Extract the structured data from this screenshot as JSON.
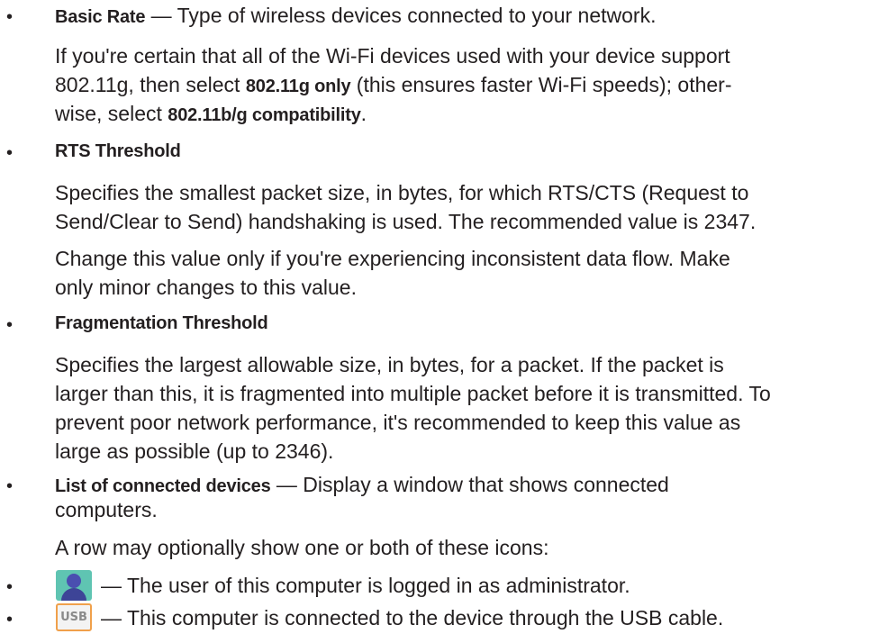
{
  "bullet_char": "•",
  "basic_rate": {
    "term": "Basic Rate",
    "desc": " — Type of wireless devices connected to your network.",
    "p1_l1": "If you're certain that all of the Wi-Fi devices used with your device support",
    "p1_l2a": "802.11g, then select ",
    "p1_l2_opt": "802.11g only",
    "p1_l2b": " (this ensures faster Wi-Fi speeds); other-",
    "p1_l3a": "wise, select ",
    "p1_l3_opt": "802.11b/g compatibility",
    "p1_l3b": "."
  },
  "rts": {
    "heading": "RTS Threshold",
    "p1_l1": "Specifies the smallest packet size, in bytes, for which RTS/CTS (Request to",
    "p1_l2": "Send/Clear to Send) handshaking is used. The recommended value is 2347.",
    "p2_l1": "Change this value only if you're experiencing inconsistent data flow. Make",
    "p2_l2": "only minor changes to this value."
  },
  "fragmentation": {
    "heading": "Fragmentation Threshold",
    "p1_l1": "Specifies the largest allowable size, in bytes, for a packet. If the packet is",
    "p1_l2": "larger than this, it is fragmented into multiple packet before it is transmitted. To",
    "p1_l3": "prevent poor network performance, it's recommended to keep this value as",
    "p1_l4": "large as possible (up to 2346)."
  },
  "connected_devices": {
    "term": "List of connected devices",
    "desc_l1": " — Display a window that shows connected",
    "desc_l2": "computers.",
    "icons_intro": "A row may optionally show one or both of these icons:"
  },
  "icons": {
    "admin_icon": "admin-user-icon",
    "admin_desc": "— The user of this computer is logged in as administrator.",
    "usb_icon": "usb-icon",
    "usb_label": "USB",
    "usb_desc": "— This computer is connected to the device through the USB cable."
  },
  "colors": {
    "text": "#231f20",
    "admin_icon_bg": "#5fc4b2",
    "admin_icon_figure": "#3d4497",
    "usb_icon_border": "#f0a04b"
  }
}
